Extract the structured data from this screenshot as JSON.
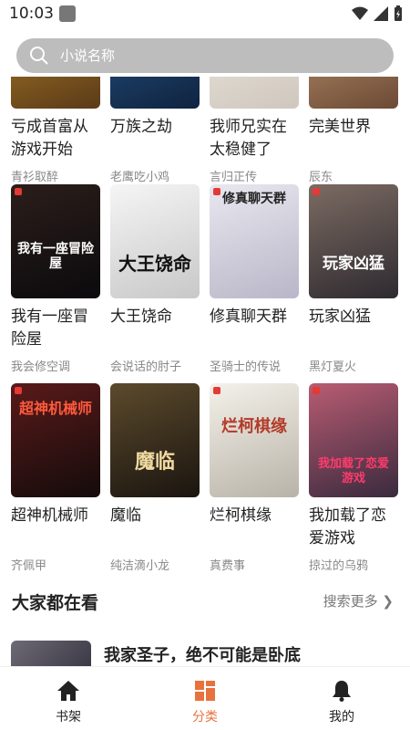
{
  "status_bar": {
    "time": "10:03"
  },
  "search": {
    "placeholder": "小说名称"
  },
  "rows": [
    {
      "books": [
        {
          "title": "亏成首富从游戏开始",
          "author": "青衫取醉",
          "colors": [
            "#b8862a",
            "#5a3a18"
          ],
          "cover_text": ""
        },
        {
          "title": "万族之劫",
          "author": "老鹰吃小鸡",
          "colors": [
            "#2a5a8c",
            "#0f2340"
          ],
          "cover_text": ""
        },
        {
          "title": "我师兄实在太稳健了",
          "author": "言归正传",
          "colors": [
            "#f0ece6",
            "#cfc7bd"
          ],
          "cover_text": ""
        },
        {
          "title": "完美世界",
          "author": "辰东",
          "colors": [
            "#c9a07a",
            "#6b4a34"
          ],
          "cover_text": ""
        }
      ]
    },
    {
      "books": [
        {
          "title": "我有一座冒险屋",
          "author": "我会修空调",
          "colors": [
            "#2b1e1a",
            "#0b0a0d"
          ],
          "cover_text": "我有一座冒险屋"
        },
        {
          "title": "大王饶命",
          "author": "会说话的肘子",
          "colors": [
            "#f5f5f5",
            "#c8c8c8"
          ],
          "cover_text": "大王饶命"
        },
        {
          "title": "修真聊天群",
          "author": "圣骑士的传说",
          "colors": [
            "#e9e7ef",
            "#b9b6c8"
          ],
          "cover_text": "修真聊天群"
        },
        {
          "title": "玩家凶猛",
          "author": "黑灯夏火",
          "colors": [
            "#7c6b62",
            "#2e2a30"
          ],
          "cover_text": "玩家凶猛"
        }
      ]
    },
    {
      "books": [
        {
          "title": "超神机械师",
          "author": "齐佩甲",
          "colors": [
            "#5a1a1a",
            "#140b0b"
          ],
          "cover_text": "超神机械师"
        },
        {
          "title": "魔临",
          "author": "纯洁滴小龙",
          "colors": [
            "#5c4a2c",
            "#1a1510"
          ],
          "cover_text": "魔临"
        },
        {
          "title": "烂柯棋缘",
          "author": "真费事",
          "colors": [
            "#f4f1ea",
            "#b8b3a8"
          ],
          "cover_text": "烂柯棋缘"
        },
        {
          "title": "我加载了恋爱游戏",
          "author": "掠过的乌鸦",
          "colors": [
            "#b85c72",
            "#3a2a3e"
          ],
          "cover_text": "我加载了恋爱游戏"
        }
      ]
    }
  ],
  "section": {
    "title": "大家都在看",
    "more": "搜索更多 ❯"
  },
  "featured": {
    "title": "我家圣子，绝不可能是卧底"
  },
  "nav": [
    {
      "label": "书架",
      "icon": "home-icon"
    },
    {
      "label": "分类",
      "icon": "category-icon"
    },
    {
      "label": "我的",
      "icon": "bell-icon"
    }
  ],
  "accent": "#e8723e"
}
